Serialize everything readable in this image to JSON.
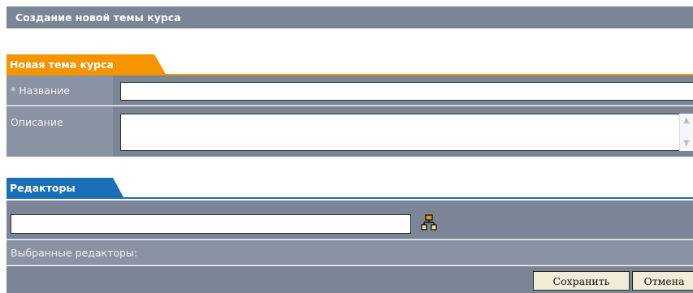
{
  "page": {
    "title": "Создание новой темы курса"
  },
  "section_topic": {
    "tab_label": "Новая тема курса",
    "name_label": "* Название",
    "name_value": "",
    "description_label": "Описание",
    "description_value": "",
    "accent_color": "#f39400"
  },
  "section_editors": {
    "tab_label": "Редакторы",
    "editor_input_value": "",
    "org_icon": "org-structure-icon",
    "selected_label": "Выбранные редакторы:",
    "accent_color": "#1b6fb7"
  },
  "buttons": {
    "save_label": "Сохранить",
    "cancel_label": "Отмена"
  }
}
